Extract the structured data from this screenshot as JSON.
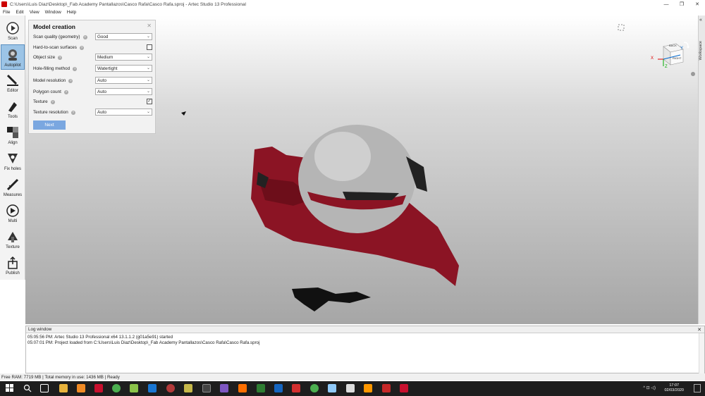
{
  "window": {
    "title": "C:\\Users\\Luis Diaz\\Desktop\\_Fab Academy Pantallazos\\Casco Rafa\\Casco Rafa.sproj - Artec Studio 13 Professional",
    "minimize": "—",
    "maximize": "❐",
    "close": "✕"
  },
  "menu": {
    "items": [
      {
        "label": "File"
      },
      {
        "label": "Edit"
      },
      {
        "label": "View"
      },
      {
        "label": "Window"
      },
      {
        "label": "Help"
      }
    ]
  },
  "toolbar": {
    "items": [
      {
        "label": "Scan",
        "icon": "scan-icon",
        "active": false
      },
      {
        "label": "Autopilot",
        "icon": "autopilot-icon",
        "active": true
      },
      {
        "label": "Editor",
        "icon": "editor-icon",
        "active": false
      },
      {
        "label": "Tools",
        "icon": "tools-icon",
        "active": false
      },
      {
        "label": "Align",
        "icon": "align-icon",
        "active": false
      },
      {
        "label": "Fix holes",
        "icon": "fix-holes-icon",
        "active": false
      },
      {
        "label": "Measures",
        "icon": "measures-icon",
        "active": false
      },
      {
        "label": "Multi",
        "icon": "multi-icon",
        "active": false
      },
      {
        "label": "Texture",
        "icon": "texture-icon",
        "active": false
      },
      {
        "label": "Publish",
        "icon": "publish-icon",
        "active": false
      }
    ]
  },
  "panel": {
    "title": "Model creation",
    "close": "✕",
    "rows": [
      {
        "label": "Scan quality (geometry)",
        "type": "select",
        "value": "Good"
      },
      {
        "label": "Hard-to-scan surfaces",
        "type": "checkbox",
        "checked": false
      },
      {
        "label": "Object size",
        "type": "select",
        "value": "Medium"
      },
      {
        "label": "Hole-filling method",
        "type": "select",
        "value": "Watertight"
      },
      {
        "label": "Model resolution",
        "type": "select",
        "value": "Auto"
      },
      {
        "label": "Polygon count",
        "type": "select",
        "value": "Auto"
      },
      {
        "label": "Texture",
        "type": "checkbox",
        "checked": true
      },
      {
        "label": "Texture resolution",
        "type": "select",
        "value": "Auto"
      }
    ],
    "help_glyph": "?",
    "check_glyph": "✓",
    "chevron_glyph": "⌄",
    "next_label": "Next"
  },
  "viewport": {
    "cube": {
      "back_label": "BACK",
      "front_label": "BACK",
      "side_label": "RIGHT"
    },
    "axes": {
      "x": "X",
      "y": "Y",
      "z": "Z"
    }
  },
  "workspace": {
    "label": "Workspace",
    "chevron": "«"
  },
  "log": {
    "title": "Log window",
    "close": "✕",
    "lines": [
      "05:05:56 PM: Artec Studio 13 Professional x64 13.1.1.2 (g01a5e91) started",
      "05:07:01 PM: Project loaded from C:\\Users\\Luis Diaz\\Desktop\\_Fab Academy Pantallazos\\Casco Rafa\\Casco Rafa.sproj"
    ]
  },
  "status": {
    "text": "Free RAM: 7719 MB  |  Total memory in use: 1436 MB  |     Ready"
  },
  "taskbar": {
    "time": "17:07",
    "date": "02/03/2020",
    "tray": "^ ⊡ ◁)",
    "colors": {
      "bar": "#1e1e1e",
      "accent": "#c8102e"
    }
  },
  "colors": {
    "scan_red": "#8b1424",
    "scan_gray": "#b5b5b5",
    "active_tool": "#9cc4e6",
    "next_button": "#7aa7e0"
  }
}
